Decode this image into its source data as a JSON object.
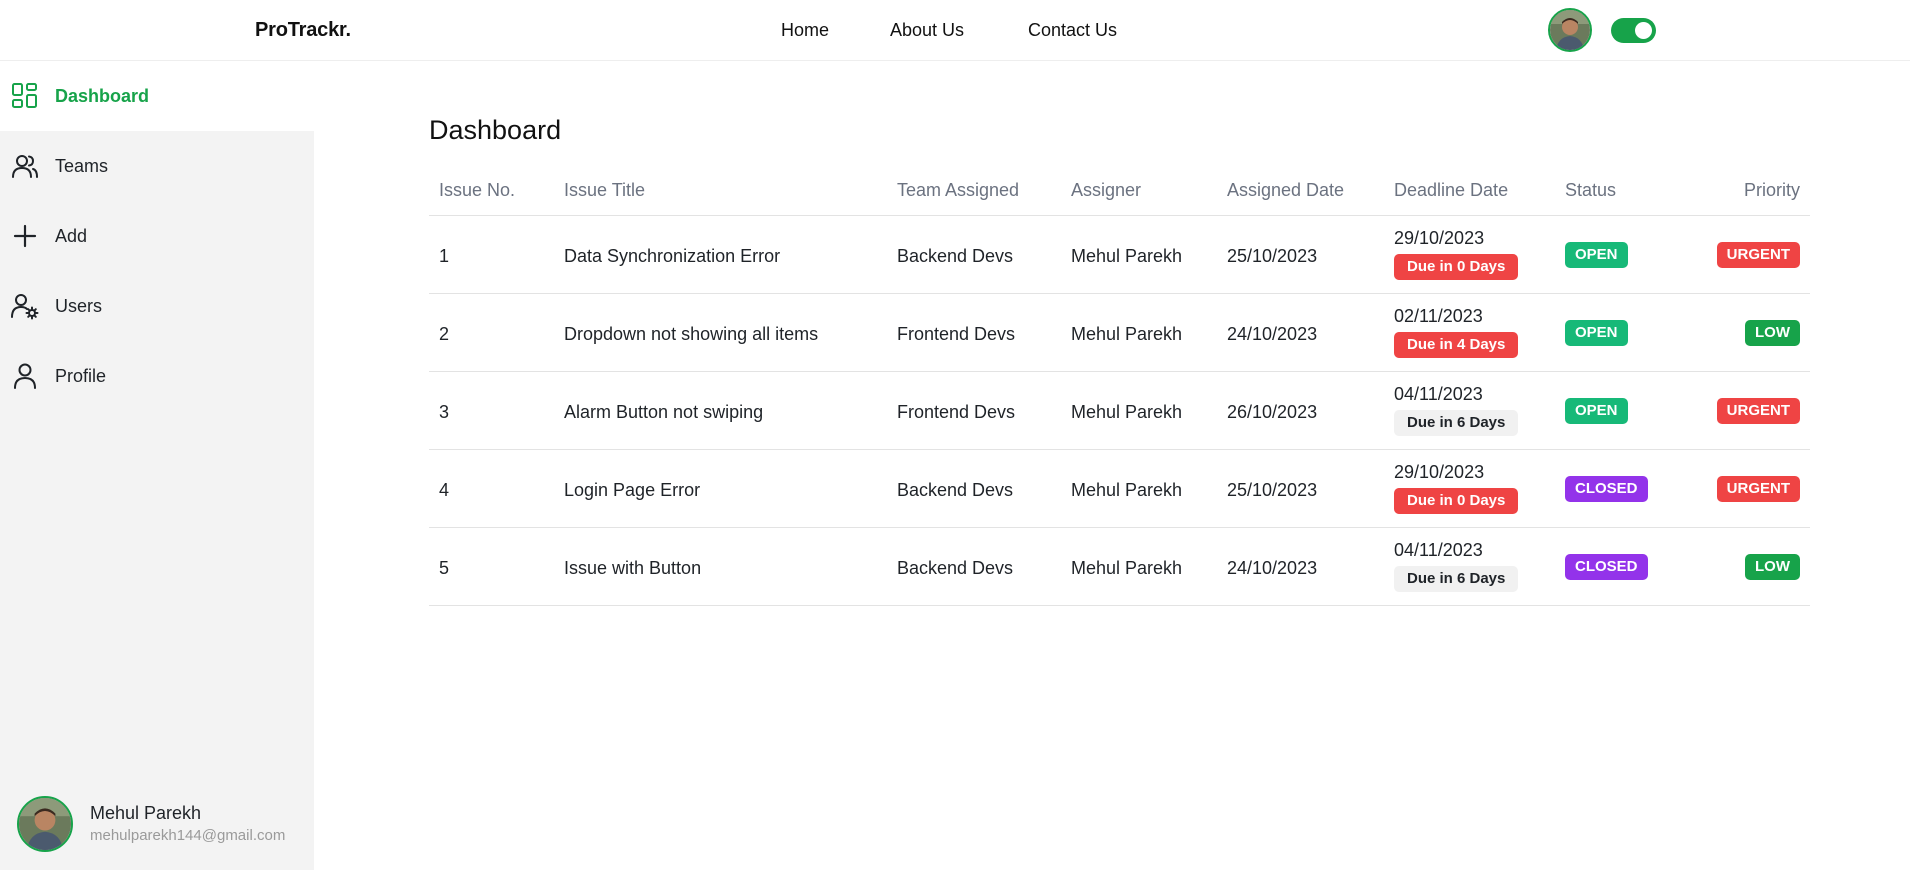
{
  "brand": "ProTrackr.",
  "nav": {
    "home": "Home",
    "about": "About Us",
    "contact": "Contact Us"
  },
  "theme_toggle": {
    "state": "on"
  },
  "sidebar": {
    "items": [
      {
        "label": "Dashboard",
        "icon": "grid-icon",
        "active": true
      },
      {
        "label": "Teams",
        "icon": "users-icon",
        "active": false
      },
      {
        "label": "Add",
        "icon": "plus-icon",
        "active": false
      },
      {
        "label": "Users",
        "icon": "user-settings-icon",
        "active": false
      },
      {
        "label": "Profile",
        "icon": "user-icon",
        "active": false
      }
    ],
    "user": {
      "name": "Mehul Parekh",
      "email": "mehulparekh144@gmail.com"
    }
  },
  "main": {
    "title": "Dashboard",
    "columns": [
      "Issue No.",
      "Issue Title",
      "Team Assigned",
      "Assigner",
      "Assigned Date",
      "Deadline Date",
      "Status",
      "Priority"
    ],
    "rows": [
      {
        "no": "1",
        "title": "Data Synchronization Error",
        "team": "Backend Devs",
        "assigner": "Mehul Parekh",
        "assigned": "25/10/2023",
        "deadline": "29/10/2023",
        "due": "Due in 0 Days",
        "status": "OPEN",
        "priority": "URGENT"
      },
      {
        "no": "2",
        "title": "Dropdown not showing all items",
        "team": "Frontend Devs",
        "assigner": "Mehul Parekh",
        "assigned": "24/10/2023",
        "deadline": "02/11/2023",
        "due": "Due in 4 Days",
        "status": "OPEN",
        "priority": "LOW"
      },
      {
        "no": "3",
        "title": "Alarm Button not swiping",
        "team": "Frontend Devs",
        "assigner": "Mehul Parekh",
        "assigned": "26/10/2023",
        "deadline": "04/11/2023",
        "due": "Due in 6 Days",
        "status": "OPEN",
        "priority": "URGENT"
      },
      {
        "no": "4",
        "title": "Login Page Error",
        "team": "Backend Devs",
        "assigner": "Mehul Parekh",
        "assigned": "25/10/2023",
        "deadline": "29/10/2023",
        "due": "Due in 0 Days",
        "status": "CLOSED",
        "priority": "URGENT"
      },
      {
        "no": "5",
        "title": "Issue with Button",
        "team": "Backend Devs",
        "assigner": "Mehul Parekh",
        "assigned": "24/10/2023",
        "deadline": "04/11/2023",
        "due": "Due in 6 Days",
        "status": "CLOSED",
        "priority": "LOW"
      }
    ]
  },
  "colors": {
    "accent": "#17a34a",
    "sidebar_bg": "#f3f3f3",
    "open": "#17b978",
    "closed": "#9333ea",
    "urgent": "#ef4444",
    "low": "#17a34a",
    "due_urgent": "#ef4444",
    "due_normal": "#f1f1f1"
  }
}
